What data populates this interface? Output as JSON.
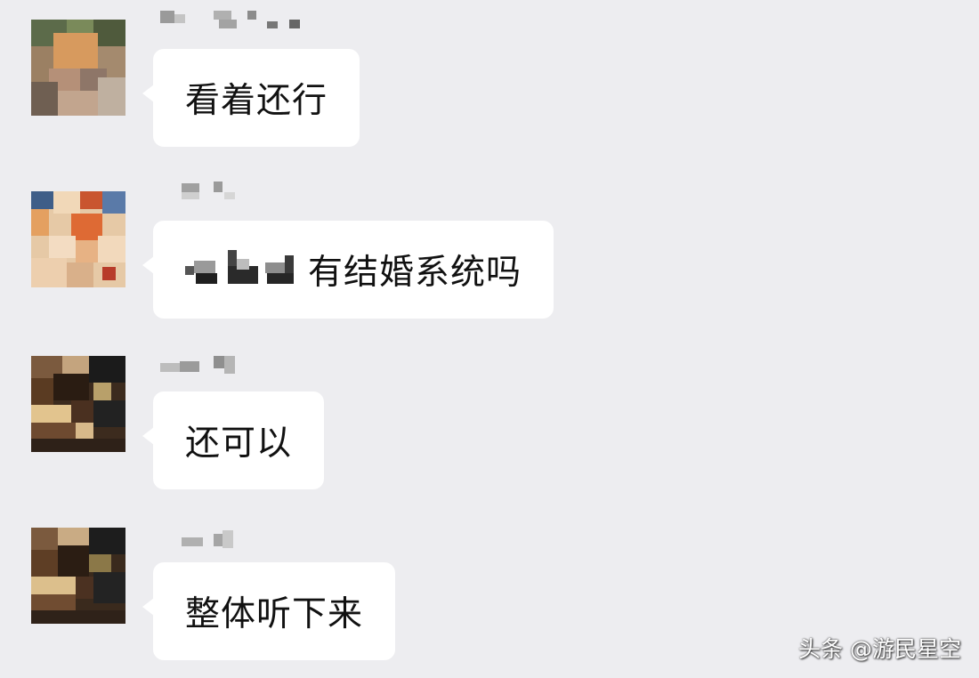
{
  "colors": {
    "background": "#ededf0",
    "bubble": "#ffffff",
    "text": "#111111"
  },
  "messages": [
    {
      "text": "看着还行",
      "avatar_icon": "blurred-avatar-icon",
      "has_redacted_prefix": false
    },
    {
      "text": "有结婚系统吗",
      "avatar_icon": "blurred-avatar-icon",
      "has_redacted_prefix": true
    },
    {
      "text": "还可以",
      "avatar_icon": "blurred-avatar-icon",
      "has_redacted_prefix": false
    },
    {
      "text": "整体听下来",
      "avatar_icon": "blurred-avatar-icon",
      "has_redacted_prefix": false
    }
  ],
  "watermark": {
    "text": "头条 @游民星空"
  }
}
